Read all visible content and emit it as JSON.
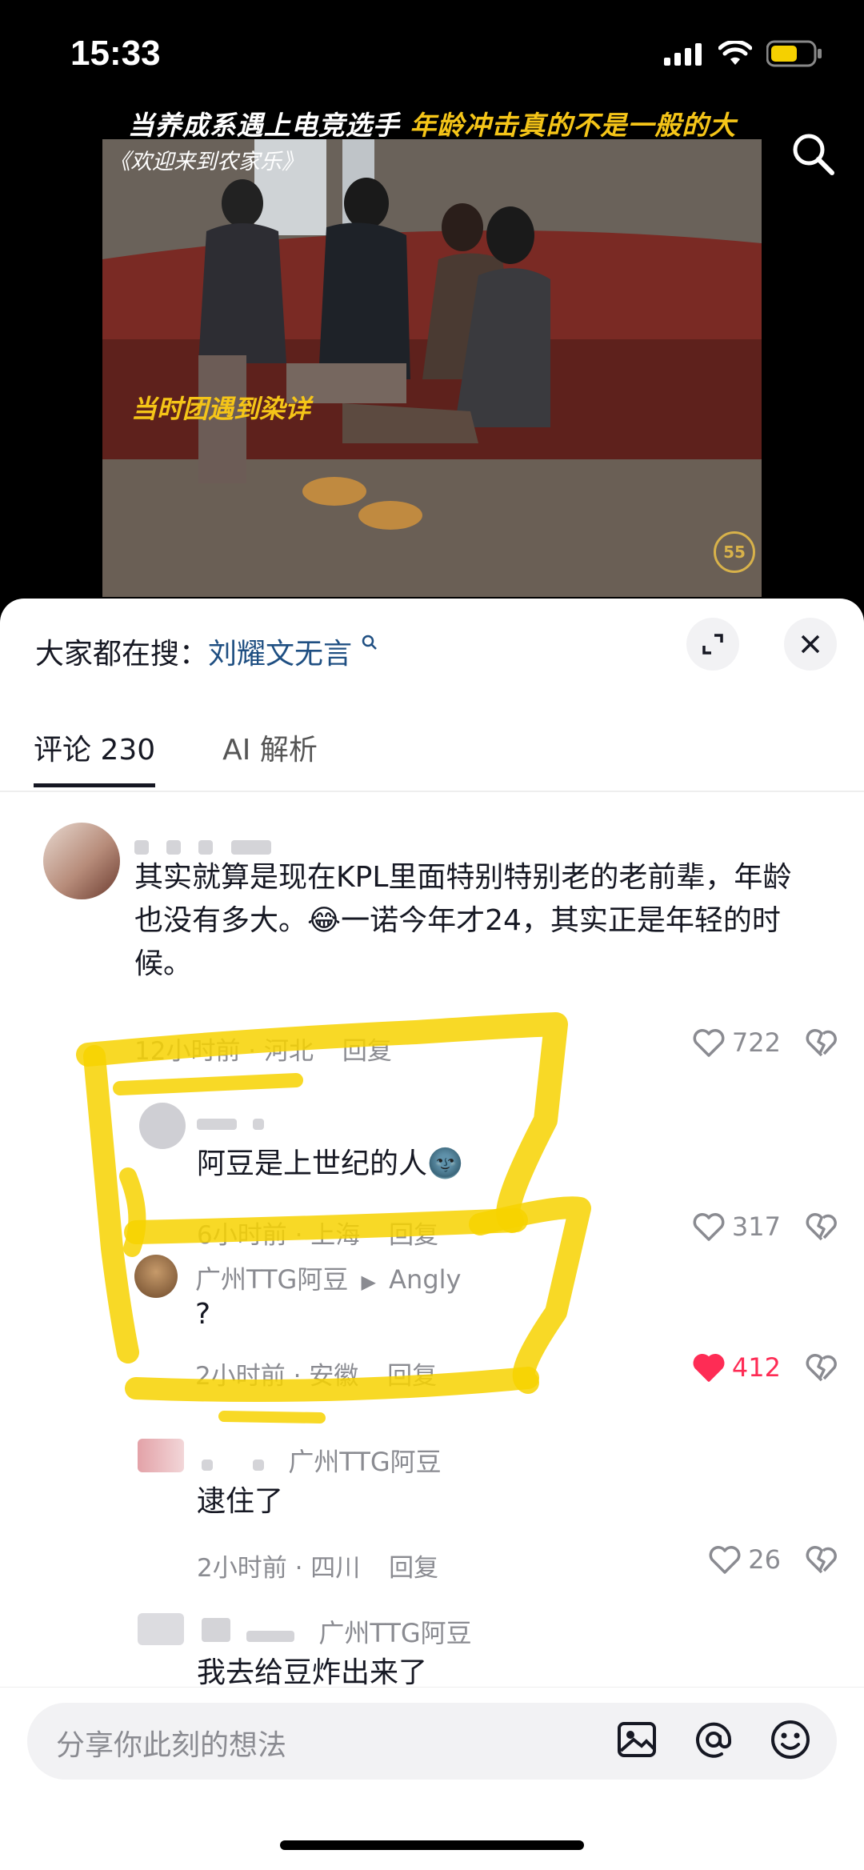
{
  "status_bar": {
    "time": "15:33"
  },
  "video": {
    "caption_prefix": "当养成系遇上电竞选手",
    "caption_highlight": "年龄冲击真的不是一般的大",
    "show_title": "《欢迎来到农家乐》",
    "subtitle": "当时团遇到染详",
    "logo_text": "55"
  },
  "hot_search": {
    "label": "大家都在搜：",
    "keyword": "刘耀文无言"
  },
  "tabs": [
    {
      "label": "评论 230",
      "active": true
    },
    {
      "label": "AI 解析",
      "active": false
    }
  ],
  "comments": [
    {
      "text": "其实就算是现在KPL里面特别特别老的老前辈，年龄也没有多大。😂一诺今年才24，其实正是年轻的时候。",
      "time": "12小时前",
      "location": "河北",
      "reply": "回复",
      "likes": "722"
    },
    {
      "text": "阿豆是上世纪的人🌚",
      "time": "6小时前",
      "location": "上海",
      "reply": "回复",
      "likes": "317"
    },
    {
      "nickname": "广州TTG阿豆",
      "reply_to": "Angly",
      "text": "?",
      "time": "2小时前",
      "location": "安徽",
      "reply": "回复",
      "likes": "412",
      "liked": true
    },
    {
      "reply_to": "广州TTG阿豆",
      "text": "逮住了",
      "time": "2小时前",
      "location": "四川",
      "reply": "回复",
      "likes": "26"
    },
    {
      "reply_to": "广州TTG阿豆",
      "text": "我去给豆炸出来了"
    }
  ],
  "input": {
    "placeholder": "分享你此刻的想法"
  },
  "colors": {
    "like_active": "#fe2c55",
    "highlight": "#f5c518",
    "marker": "#f7d200"
  }
}
